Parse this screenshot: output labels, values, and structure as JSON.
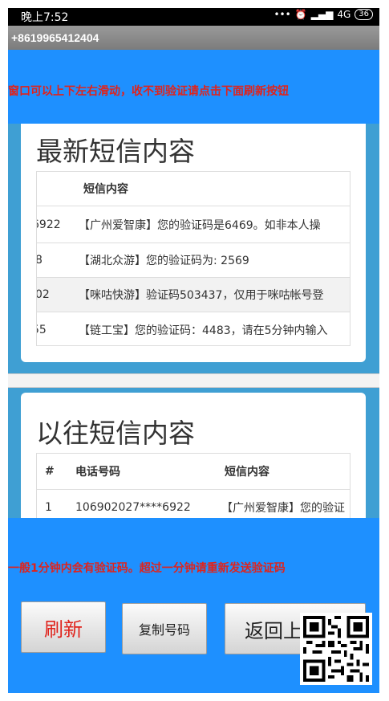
{
  "status_bar": {
    "time": "晚上7:52",
    "icons": [
      "more-dots-icon",
      "alarm-icon",
      "hd-signal-icon",
      "signal-4g-icon"
    ],
    "network": "4G",
    "battery": "36"
  },
  "title_bar": {
    "phone": "+8619965412404"
  },
  "top_notice": "窗口可以上下左右滑动，收不到验证请点击下面刷新按钮",
  "latest": {
    "title": "最新短信内容",
    "header": "短信内容",
    "rows": [
      {
        "num": "6922",
        "content": "【广州爱智康】您的验证码是6469。如非本人操"
      },
      {
        "num": "8",
        "content": "【湖北众游】您的验证码为: 2569"
      },
      {
        "num": "02",
        "content": "【咪咕快游】验证码503437，仅用于咪咕帐号登"
      },
      {
        "num": "55",
        "content": "【链工宝】您的验证码：4483，请在5分钟内输入"
      }
    ]
  },
  "history": {
    "title": "以往短信内容",
    "headers": [
      "#",
      "电话号码",
      "短信内容"
    ],
    "rows": [
      {
        "idx": "1",
        "phone": "106902027****6922",
        "content": "【广州爱智康】您的验证"
      }
    ]
  },
  "bottom_notice": "一般1分钟内会有验证码。超过一分钟请重新发送验证码",
  "buttons": {
    "refresh": "刷新",
    "copy": "复制号码",
    "back": "返回上"
  },
  "colors": {
    "blue": "#1e90ff",
    "panel_blue": "#3f9fd3",
    "notice_red": "#e0231c"
  }
}
